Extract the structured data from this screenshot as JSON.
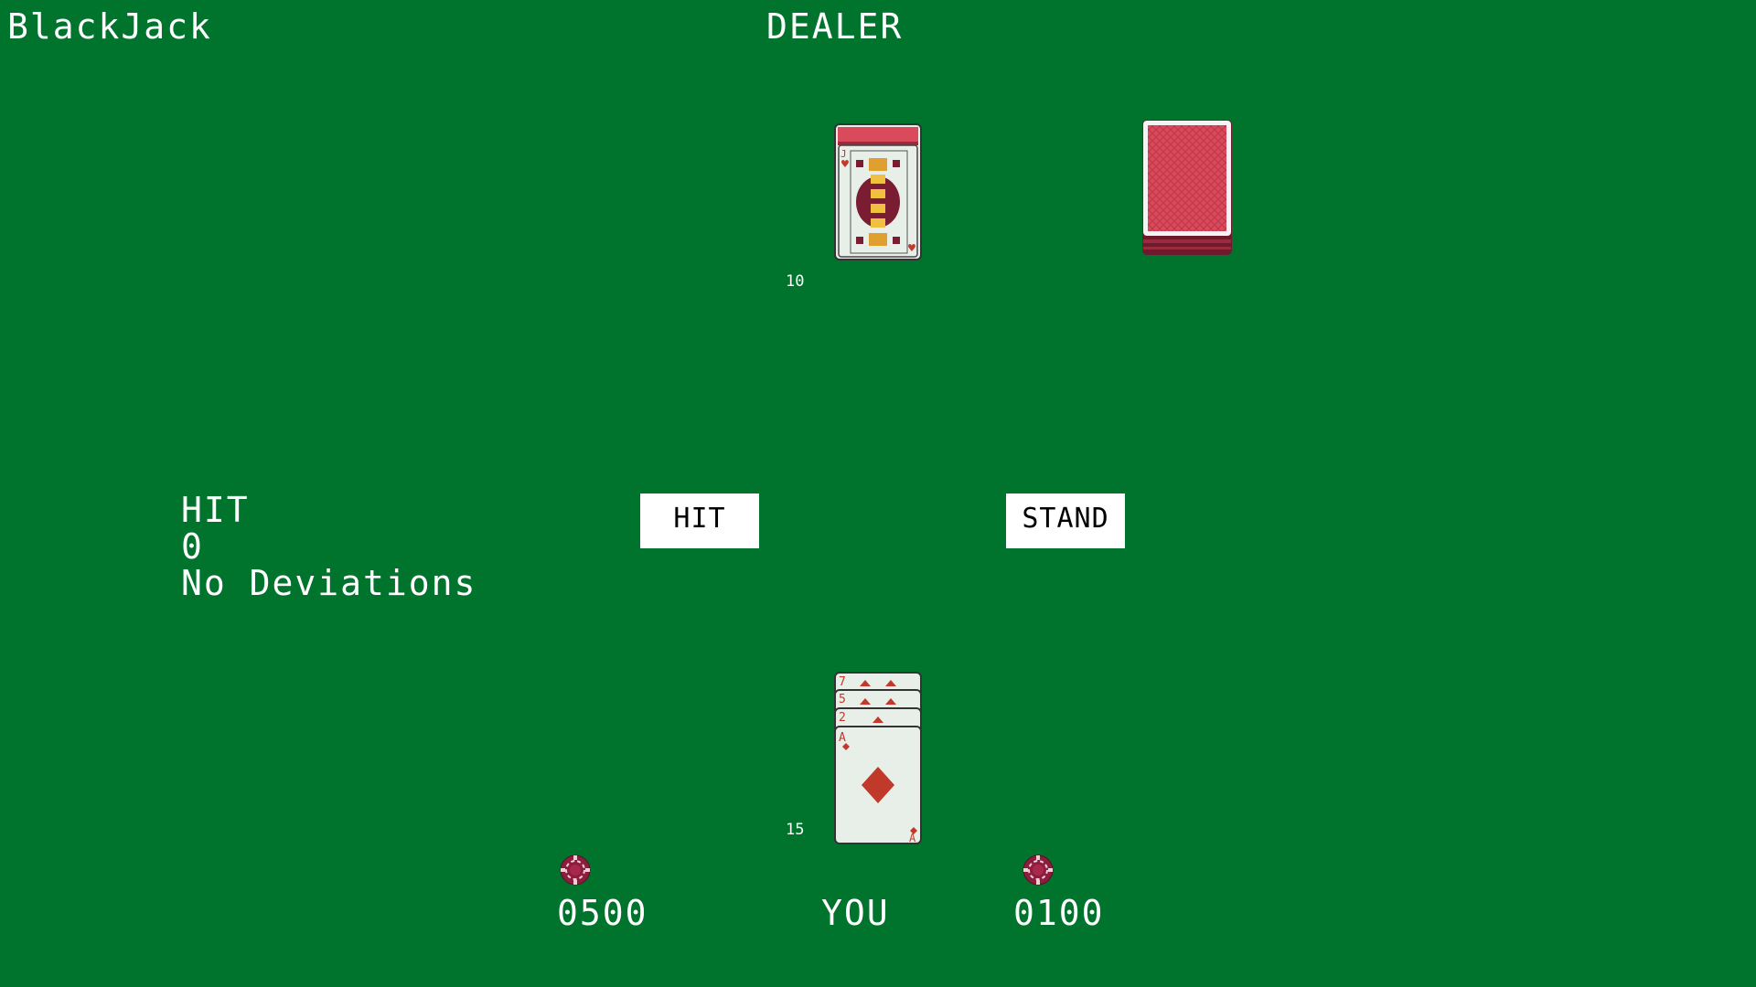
{
  "header": {
    "app_title": "BlackJack",
    "dealer_title": "DEALER"
  },
  "dealer": {
    "score": "10",
    "cards": [
      {
        "rank": "J",
        "suit": "hearts",
        "face_up": true
      },
      {
        "rank": "",
        "suit": "",
        "face_up": false
      }
    ]
  },
  "player": {
    "label": "YOU",
    "score": "15",
    "cards": [
      {
        "rank": "7",
        "suit": "diamonds"
      },
      {
        "rank": "5",
        "suit": "diamonds"
      },
      {
        "rank": "2",
        "suit": "diamonds"
      },
      {
        "rank": "A",
        "suit": "diamonds"
      }
    ],
    "bank": "0500",
    "bet": "0100"
  },
  "advice": {
    "action": "HIT",
    "count": "0",
    "deviation": "No Deviations"
  },
  "controls": {
    "hit_label": "HIT",
    "stand_label": "STAND"
  },
  "icons": {
    "chip": "poker-chip-icon",
    "deck": "card-deck-icon"
  },
  "colors": {
    "table": "#00742c",
    "card_back": "#d94b5c",
    "chip": "#8c1d3d",
    "suit_red": "#c0392b"
  }
}
